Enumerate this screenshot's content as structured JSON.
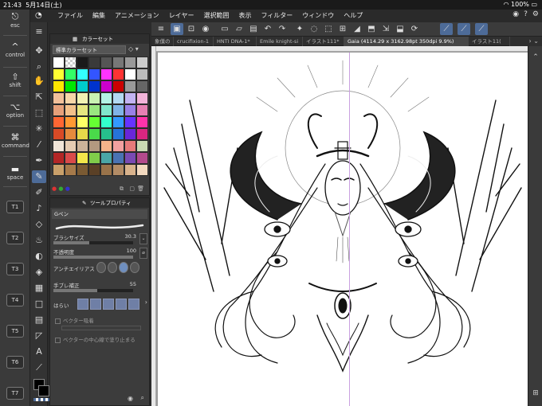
{
  "status": {
    "time": "21:43",
    "date": "5月14日(土)",
    "battery": "100%"
  },
  "menu": {
    "items": [
      "ファイル",
      "編集",
      "アニメーション",
      "レイヤー",
      "選択範囲",
      "表示",
      "フィルター",
      "ウィンドウ",
      "ヘルプ"
    ]
  },
  "modifiers": {
    "esc": "esc",
    "control": "control",
    "shift": "shift",
    "option": "option",
    "command": "command",
    "space": "space",
    "t_keys": [
      "T1",
      "T2",
      "T3",
      "T4",
      "T5",
      "T6",
      "T7"
    ]
  },
  "tabs": [
    {
      "label": "象僕の",
      "active": false
    },
    {
      "label": "crucifixion-1",
      "active": false
    },
    {
      "label": "HNTI DNA-1*",
      "active": false
    },
    {
      "label": "Emile knight-si",
      "active": false
    },
    {
      "label": "イラスト111*",
      "active": false
    },
    {
      "label": "Gaia (4114.29 x 3162.98pt 350dpi 9.9%)",
      "active": true
    },
    {
      "label": "イラスト11(",
      "active": false
    }
  ],
  "color_panel": {
    "title": "カラーセット",
    "set_name": "標準カラーセット",
    "swatches": [
      "#ffffff",
      "#f4f4f4",
      "#1a1a1a",
      "#3a3a3a",
      "#555555",
      "#777777",
      "#999999",
      "#cccccc",
      "#ffff33",
      "#33ff66",
      "#33ffff",
      "#3355ff",
      "#ff33ff",
      "#ff3333",
      "#ffffff",
      "#bbbbbb",
      "#ffe600",
      "#00e600",
      "#00cccc",
      "#0033cc",
      "#cc00cc",
      "#cc0000",
      "#999999",
      "#666666",
      "#f2c09a",
      "#f7d6a8",
      "#f2f2b3",
      "#c9f2b3",
      "#b3f2e6",
      "#b3d9f2",
      "#c2b3f2",
      "#f2b3d9",
      "#e6a07a",
      "#f2c08a",
      "#e6e680",
      "#99e680",
      "#80e6cc",
      "#80b3e6",
      "#9980e6",
      "#e680b3",
      "#ff6633",
      "#ff9933",
      "#ffff66",
      "#66ff33",
      "#33ffcc",
      "#3399ff",
      "#6633ff",
      "#ff33aa",
      "#d94a26",
      "#e68a3d",
      "#e6d94a",
      "#4ad94a",
      "#26bf8c",
      "#2673d9",
      "#6a26d9",
      "#d92680",
      "#f2e6d9",
      "#e6ccb3",
      "#ccb399",
      "#b39980",
      "#f5b38a",
      "#f2a0a0",
      "#e67a7a",
      "#c9d9b3",
      "#b32626",
      "#d94a4a",
      "#f2e64a",
      "#80cc4a",
      "#4aa6a6",
      "#4a73b3",
      "#7a4ab3",
      "#b34a8c",
      "#c9a06a",
      "#a67a4a",
      "#7a5a33",
      "#5a4026",
      "#99734a",
      "#b38c66",
      "#d9b38c",
      "#f2d9bf"
    ]
  },
  "prop_panel": {
    "title": "ツールプロパティ",
    "pen_name": "Gペン",
    "brush_size": {
      "label": "ブラシサイズ",
      "value": "30.3",
      "fill": 0.45
    },
    "opacity": {
      "label": "不透明度",
      "value": "100",
      "fill": 1.0
    },
    "antialias": {
      "label": "アンチエイリアス"
    },
    "stabilization": {
      "label": "手ブレ補正",
      "value": "55",
      "fill": 0.55
    },
    "taper": {
      "label": "はらい"
    },
    "vector_snap": "ベクター吸着",
    "vector_center": "ベクターの中心線で塗り止まる"
  },
  "colors": {
    "accent": "#4d6b98",
    "canvas_bg": "#9a9a9a",
    "guide": "#c9a0e0"
  }
}
